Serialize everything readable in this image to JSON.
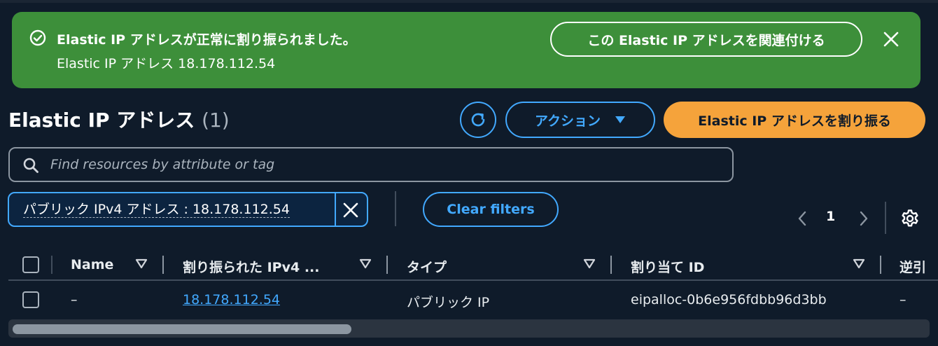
{
  "flash": {
    "title": "Elastic IP アドレスが正常に割り振られました。",
    "subtitle": "Elastic IP アドレス 18.178.112.54",
    "associate_label": "この Elastic IP アドレスを関連付ける",
    "icons": {
      "status": "check-circle-icon",
      "close": "close-icon"
    }
  },
  "header": {
    "title": "Elastic IP アドレス",
    "count": "(1)",
    "actions_label": "アクション",
    "allocate_label": "Elastic IP アドレスを割り振る"
  },
  "search": {
    "placeholder": "Find resources by attribute or tag",
    "value": ""
  },
  "filter": {
    "token_label": "パブリック IPv4 アドレス : 18.178.112.54",
    "clear_label": "Clear filters"
  },
  "pagination": {
    "current_page": "1"
  },
  "table": {
    "columns": [
      "Name",
      "割り振られた IPv4 ...",
      "タイプ",
      "割り当て ID",
      "逆引"
    ],
    "rows": [
      {
        "name": "–",
        "ip": "18.178.112.54",
        "type": "パブリック IP",
        "allocation_id": "eipalloc-0b6e956fdbb96d3bb",
        "reverse": "–"
      }
    ]
  },
  "scrollbar": {
    "position_fraction": 0.0,
    "visible_fraction": 0.37
  },
  "colors": {
    "background": "#0f1b2a",
    "success": "#3d8f3a",
    "accent": "#42a9ff",
    "primary": "#f5a33b"
  }
}
